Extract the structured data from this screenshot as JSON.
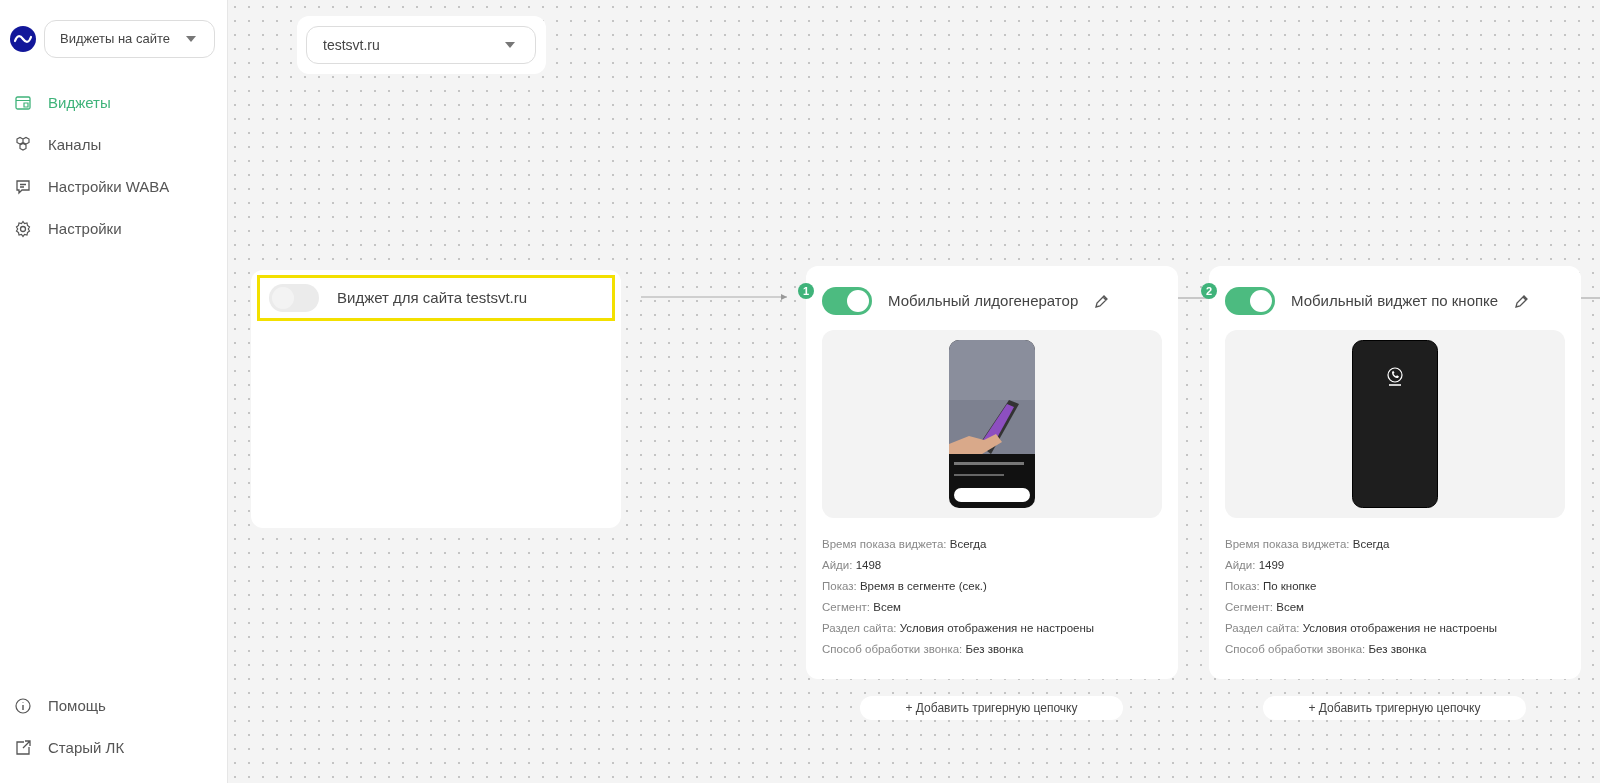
{
  "sidebar": {
    "section_select": {
      "value": "Виджеты на сайте"
    },
    "items": [
      {
        "label": "Виджеты",
        "selected": true
      },
      {
        "label": "Каналы",
        "selected": false
      },
      {
        "label": "Настройки WABA",
        "selected": false
      },
      {
        "label": "Настройки",
        "selected": false
      }
    ],
    "footer_items": [
      {
        "label": "Помощь"
      },
      {
        "label": "Старый ЛК"
      }
    ]
  },
  "site_select": {
    "value": "testsvt.ru"
  },
  "root_node": {
    "title": "Виджет для сайта testsvt.ru",
    "on": false,
    "highlighted": true
  },
  "widgets": [
    {
      "number": "1",
      "title": "Мобильный лидогенератор",
      "on": true,
      "rows": [
        {
          "label": "Время показа виджета:",
          "value": "Всегда"
        },
        {
          "label": "Айди:",
          "value": "1498"
        },
        {
          "label": "Показ:",
          "value": "Время в сегменте (сек.)"
        },
        {
          "label": "Сегмент:",
          "value": "Всем"
        },
        {
          "label": "Раздел сайта:",
          "value": "Условия отображения не настроены"
        },
        {
          "label": "Способ обработки звонка:",
          "value": "Без звонка"
        }
      ],
      "add_button": "+ Добавить тригерную цепочку"
    },
    {
      "number": "2",
      "title": "Мобильный виджет по кнопке",
      "on": true,
      "kind": "call",
      "rows": [
        {
          "label": "Время показа виджета:",
          "value": "Всегда"
        },
        {
          "label": "Айди:",
          "value": "1499"
        },
        {
          "label": "Показ:",
          "value": "По кнопке"
        },
        {
          "label": "Сегмент:",
          "value": "Всем"
        },
        {
          "label": "Раздел сайта:",
          "value": "Условия отображения не настроены"
        },
        {
          "label": "Способ обработки звонка:",
          "value": "Без звонка"
        }
      ],
      "add_button": "+ Добавить тригерную цепочку"
    }
  ]
}
